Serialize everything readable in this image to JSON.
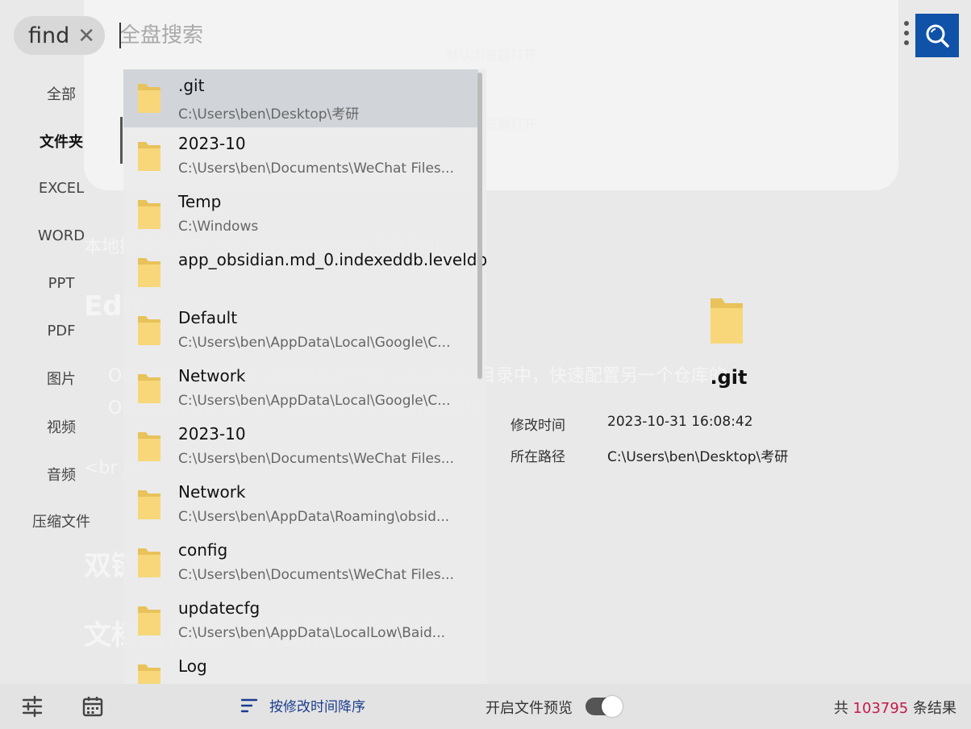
{
  "search": {
    "chip_text": "find",
    "placeholder": "全盘搜索",
    "value": ""
  },
  "sidebar": {
    "items": [
      {
        "label": "全部",
        "active": false
      },
      {
        "label": "文件夹",
        "active": true
      },
      {
        "label": "EXCEL",
        "active": false
      },
      {
        "label": "WORD",
        "active": false
      },
      {
        "label": "PPT",
        "active": false
      },
      {
        "label": "PDF",
        "active": false
      },
      {
        "label": "图片",
        "active": false
      },
      {
        "label": "视频",
        "active": false
      },
      {
        "label": "音频",
        "active": false
      },
      {
        "label": "压缩文件",
        "active": false
      }
    ]
  },
  "results": [
    {
      "name": ".git",
      "path": "C:\\Users\\ben\\Desktop\\考研",
      "selected": true
    },
    {
      "name": "2023-10",
      "path": "C:\\Users\\ben\\Documents\\WeChat Files..."
    },
    {
      "name": "Temp",
      "path": "C:\\Windows"
    },
    {
      "name": "app_obsidian.md_0.indexeddb.leveldb",
      "path": ""
    },
    {
      "name": "Default",
      "path": "C:\\Users\\ben\\AppData\\Local\\Google\\C..."
    },
    {
      "name": "Network",
      "path": "C:\\Users\\ben\\AppData\\Local\\Google\\C..."
    },
    {
      "name": "2023-10",
      "path": "C:\\Users\\ben\\Documents\\WeChat Files..."
    },
    {
      "name": "Network",
      "path": "C:\\Users\\ben\\AppData\\Roaming\\obsid..."
    },
    {
      "name": "config",
      "path": "C:\\Users\\ben\\Documents\\WeChat Files..."
    },
    {
      "name": "updatecfg",
      "path": "C:\\Users\\ben\\AppData\\LocalLow\\Baid..."
    },
    {
      "name": "Log",
      "path": ""
    }
  ],
  "preview": {
    "name": ".git",
    "modified_label": "修改时间",
    "modified_value": "2023-10-31 16:08:42",
    "path_label": "所在路径",
    "path_value": "C:\\Users\\ben\\Desktop\\考研"
  },
  "bottombar": {
    "sort_label": "按修改时间降序",
    "preview_toggle_label": "开启文件预览",
    "preview_enabled": true,
    "count_prefix": "共",
    "count_value": "103795",
    "count_suffix": "条结果"
  },
  "backdrop": {
    "lines": [
      "本地搜索是基于 everything 软件进行搜索的",
      "Edit",
      "Obsidian 的配置存储在根目录下的 .obsidian 目录中，快速配置另一个仓库的",
      "Obsidian插件信息，只需要复制文件夹过去即可",
      "<br />",
      "双链",
      "文档附件统一存放指定文件夹",
      "默认浏览器打开",
      "默认浏览器打开"
    ]
  },
  "colors": {
    "accent": "#0f52a8",
    "count_highlight": "#c21b4a",
    "sort_text": "#1a3d8f"
  }
}
